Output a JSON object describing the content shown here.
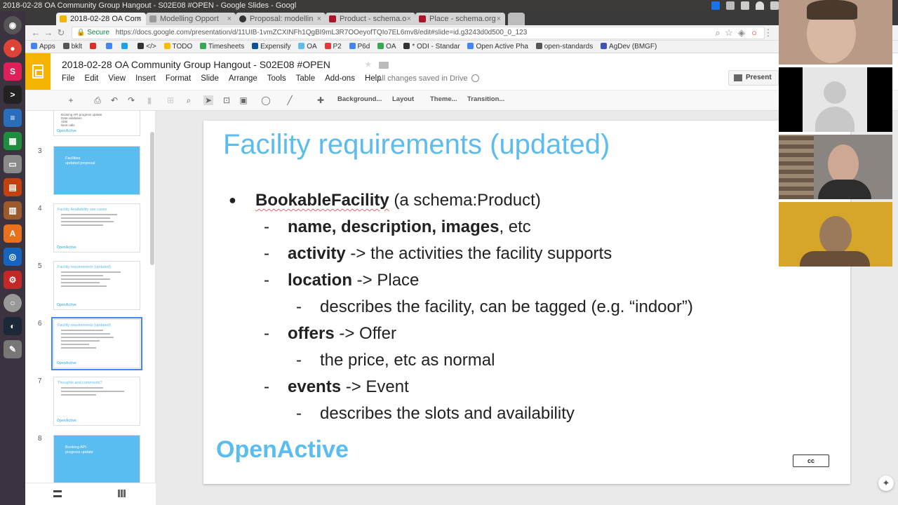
{
  "window": {
    "title": "2018-02-28 OA Community Group Hangout - S02E08 #OPEN - Google Slides - Googl"
  },
  "tabs": [
    {
      "label": "2018-02-28 OA Com",
      "color": "#f4b400"
    },
    {
      "label": "Modelling Opport",
      "color": "#999999"
    },
    {
      "label": "Proposal: modellin",
      "color": "#333333"
    },
    {
      "label": "Product - schema.o",
      "color": "#b0122a"
    },
    {
      "label": "Place - schema.org",
      "color": "#b0122a"
    }
  ],
  "address_bar": {
    "secure_label": "Secure",
    "url": "https://docs.google.com/presentation/d/11UIB-1vmZCXINFh1QgBI9mL3R7OOeyofTQIo7EL6mv8/edit#slide=id.g3243d0d500_0_123"
  },
  "bookmarks": [
    {
      "label": "Apps",
      "color": "#4285f4"
    },
    {
      "label": "bklt",
      "color": "#555555"
    },
    {
      "label": "",
      "color": "#d93025"
    },
    {
      "label": "",
      "color": "#4285f4"
    },
    {
      "label": "",
      "color": "#1da1f2"
    },
    {
      "label": "</>",
      "color": "#333333"
    },
    {
      "label": "TODO",
      "color": "#fbbc04"
    },
    {
      "label": "Timesheets",
      "color": "#34a853"
    },
    {
      "label": "Expensify",
      "color": "#0b5394"
    },
    {
      "label": "OA",
      "color": "#5bbcf0"
    },
    {
      "label": "P2",
      "color": "#e53935"
    },
    {
      "label": "P6d",
      "color": "#4285f4"
    },
    {
      "label": "OA",
      "color": "#34a853"
    },
    {
      "label": "* ODI - Standar",
      "color": "#333333"
    },
    {
      "label": "Open Active Pha",
      "color": "#4285f4"
    },
    {
      "label": "open-standards",
      "color": "#555555"
    },
    {
      "label": "AgDev (BMGF)",
      "color": "#3f51b5"
    }
  ],
  "app": {
    "doc_title": "2018-02-28 OA Community Group Hangout - S02E08 #OPEN",
    "menu": [
      "File",
      "Edit",
      "View",
      "Insert",
      "Format",
      "Slide",
      "Arrange",
      "Tools",
      "Table",
      "Add-ons",
      "Help"
    ],
    "save_status": "All changes saved in Drive",
    "present_label": "Present",
    "toolbar_buttons": [
      "Background...",
      "Layout",
      "Theme...",
      "Transition..."
    ]
  },
  "filmstrip": {
    "slides": [
      {
        "number": "",
        "title": "",
        "lines": [
          "Booking API progress update",
          "Data validation",
          "ADB",
          "Next calls"
        ],
        "brand": "OpenActive",
        "blue": false
      },
      {
        "number": "3",
        "title": "Facilities\nupdated proposal",
        "lines": [],
        "brand": "",
        "blue": true
      },
      {
        "number": "4",
        "title": "Facility Availability use cases",
        "lines": [],
        "brand": "OpenActive",
        "blue": false
      },
      {
        "number": "5",
        "title": "Facility requirements (updated)",
        "lines": [],
        "brand": "OpenActive",
        "blue": false
      },
      {
        "number": "6",
        "title": "Facility requirements (updated)",
        "lines": [],
        "brand": "OpenActive",
        "blue": false,
        "selected": true
      },
      {
        "number": "7",
        "title": "Thoughts and comments?",
        "lines": [],
        "brand": "OpenActive",
        "blue": false
      },
      {
        "number": "8",
        "title": "Booking API\nprogress update",
        "lines": [],
        "brand": "",
        "blue": true
      }
    ]
  },
  "slide": {
    "title": "Facility requirements (updated)",
    "rows": [
      {
        "mark": "●",
        "bold": "BookableFacility",
        "rest": " (a schema:Product)"
      },
      {
        "mark": "-",
        "bold": "name, description, images",
        "rest": ", etc"
      },
      {
        "mark": "-",
        "bold": "activity",
        "rest": " -> the activities the facility supports"
      },
      {
        "mark": "-",
        "bold": "location",
        "rest": " -> Place"
      },
      {
        "mark": "-",
        "bold": "",
        "rest": "describes the facility, can be tagged (e.g. “indoor”)"
      },
      {
        "mark": "-",
        "bold": "offers",
        "rest": " -> Offer"
      },
      {
        "mark": "-",
        "bold": "",
        "rest": "the price, etc as normal"
      },
      {
        "mark": "-",
        "bold": "events",
        "rest": " -> Event"
      },
      {
        "mark": "-",
        "bold": "",
        "rest": "describes the slots and availability"
      }
    ],
    "brand": "OpenActive",
    "license_badge": "cc"
  },
  "colors": {
    "accent": "#5bbcf0",
    "slides_yellow": "#f4b400"
  }
}
